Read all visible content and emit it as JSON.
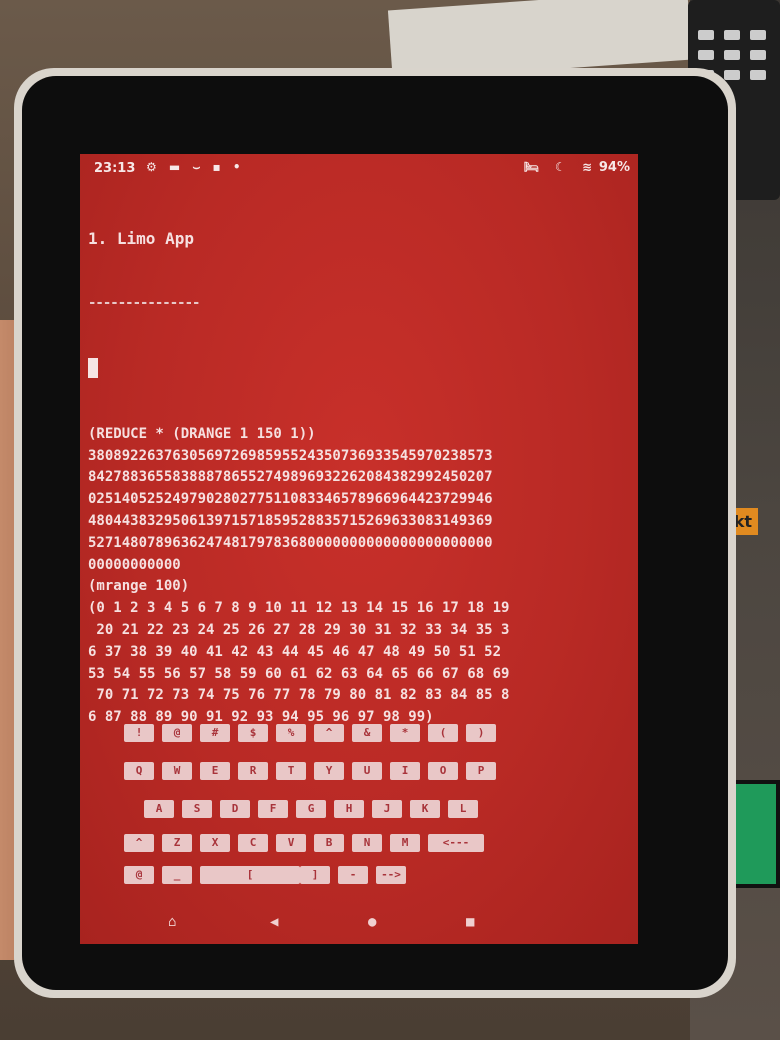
{
  "status_bar": {
    "time": "23:13",
    "left_icons": "⚙ ▬ ⌣ ▪ •",
    "right_icons": "🛏 ☾ ≋",
    "battery": "94%"
  },
  "terminal": {
    "title": "1. Limo App",
    "rule": "---------------",
    "lines": [
      "(REDUCE * (DRANGE 1 150 1))",
      "380892263763056972698595524350736933545970238573",
      "842788365583888786552749896932262084382992450207",
      "025140525249790280277511083346578966964423729946",
      "480443832950613971571859528835715269633083149369",
      "527148078963624748179783680000000000000000000000",
      "00000000000",
      "(mrange 100)",
      "(0 1 2 3 4 5 6 7 8 9 10 11 12 13 14 15 16 17 18 19",
      " 20 21 22 23 24 25 26 27 28 29 30 31 32 33 34 35 3",
      "6 37 38 39 40 41 42 43 44 45 46 47 48 49 50 51 52",
      "53 54 55 56 57 58 59 60 61 62 63 64 65 66 67 68 69",
      " 70 71 72 73 74 75 76 77 78 79 80 81 82 83 84 85 8",
      "6 87 88 89 90 91 92 93 94 95 96 97 98 99)"
    ]
  },
  "keyboard": {
    "rows": [
      [
        "!",
        "@",
        "#",
        "$",
        "%",
        "^",
        "&",
        "*",
        "(",
        ")"
      ],
      [
        "Q",
        "W",
        "E",
        "R",
        "T",
        "Y",
        "U",
        "I",
        "O",
        "P"
      ],
      [
        "A",
        "S",
        "D",
        "F",
        "G",
        "H",
        "J",
        "K",
        "L"
      ],
      [
        "^",
        "Z",
        "X",
        "C",
        "V",
        "B",
        "N",
        "M",
        "<---"
      ],
      [
        "@",
        "_",
        "[",
        "]",
        "-",
        "-->"
      ]
    ]
  },
  "navbar": {
    "home_icon": "⌂",
    "back_icon": "◀",
    "circle_icon": "●",
    "square_icon": "■"
  },
  "background": {
    "sign_text": "ckt"
  }
}
